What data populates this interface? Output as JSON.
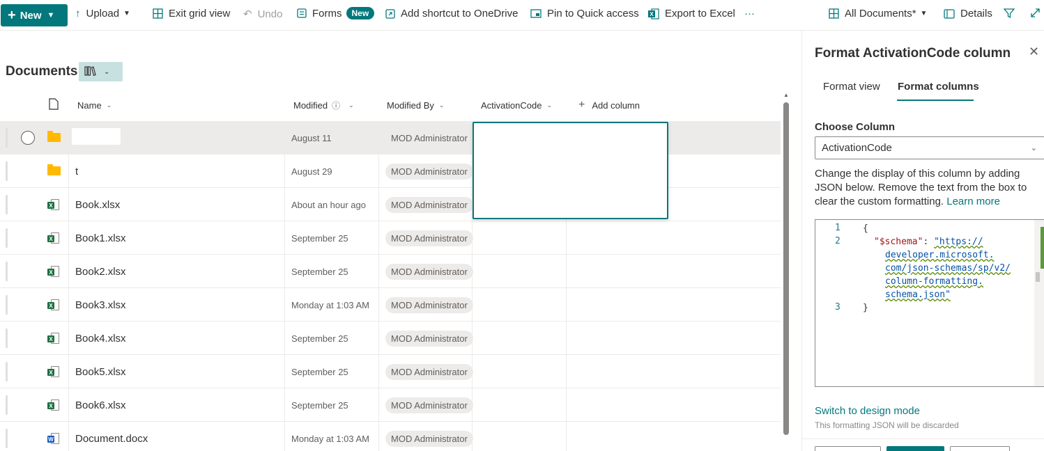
{
  "toolbar": {
    "new_label": "New",
    "upload_label": "Upload",
    "exit_grid_label": "Exit grid view",
    "undo_label": "Undo",
    "forms_label": "Forms",
    "forms_badge": "New",
    "add_shortcut_label": "Add shortcut to OneDrive",
    "pin_label": "Pin to Quick access",
    "export_label": "Export to Excel",
    "more_label": "···",
    "view_label": "All Documents*",
    "details_label": "Details"
  },
  "library": {
    "title": "Documents",
    "columns": {
      "name": "Name",
      "modified": "Modified",
      "modified_by": "Modified By",
      "activation_code": "ActivationCode",
      "add_column": "Add column"
    }
  },
  "rows": [
    {
      "type": "folder",
      "name": "",
      "modified": "August 11",
      "modified_by": "MOD Administrator",
      "selected": true
    },
    {
      "type": "folder",
      "name": "t",
      "modified": "August 29",
      "modified_by": "MOD Administrator"
    },
    {
      "type": "excel",
      "name": "Book.xlsx",
      "modified": "About an hour ago",
      "modified_by": "MOD Administrator"
    },
    {
      "type": "excel",
      "name": "Book1.xlsx",
      "modified": "September 25",
      "modified_by": "MOD Administrator"
    },
    {
      "type": "excel",
      "name": "Book2.xlsx",
      "modified": "September 25",
      "modified_by": "MOD Administrator"
    },
    {
      "type": "excel",
      "name": "Book3.xlsx",
      "modified": "Monday at 1:03 AM",
      "modified_by": "MOD Administrator"
    },
    {
      "type": "excel",
      "name": "Book4.xlsx",
      "modified": "September 25",
      "modified_by": "MOD Administrator"
    },
    {
      "type": "excel",
      "name": "Book5.xlsx",
      "modified": "September 25",
      "modified_by": "MOD Administrator"
    },
    {
      "type": "excel",
      "name": "Book6.xlsx",
      "modified": "September 25",
      "modified_by": "MOD Administrator"
    },
    {
      "type": "word",
      "name": "Document.docx",
      "modified": "Monday at 1:03 AM",
      "modified_by": "MOD Administrator"
    }
  ],
  "panel": {
    "title": "Format ActivationCode column",
    "tab_view": "Format view",
    "tab_columns": "Format columns",
    "choose_label": "Choose Column",
    "selected_column": "ActivationCode",
    "description": "Change the display of this column by adding JSON below. Remove the text from the box to clear the custom formatting.",
    "learn_more": "Learn more",
    "code_lines": {
      "ln1": "1",
      "ln2": "2",
      "ln3": "3",
      "open": "{",
      "key": "\"$schema\"",
      "colon": ": ",
      "url1": "\"https://",
      "url2": "developer.microsoft.",
      "url3": "com/json-schemas/sp/v2/",
      "url4": "column-formatting.",
      "url5": "schema.json\"",
      "close": "}"
    },
    "switch_label": "Switch to design mode",
    "note": "This formatting JSON will be discarded"
  },
  "colors": {
    "accent": "#03787c",
    "selected_row": "#edebe9",
    "folder": "#ffb900",
    "excel": "#1d6f42",
    "word": "#185abd"
  }
}
